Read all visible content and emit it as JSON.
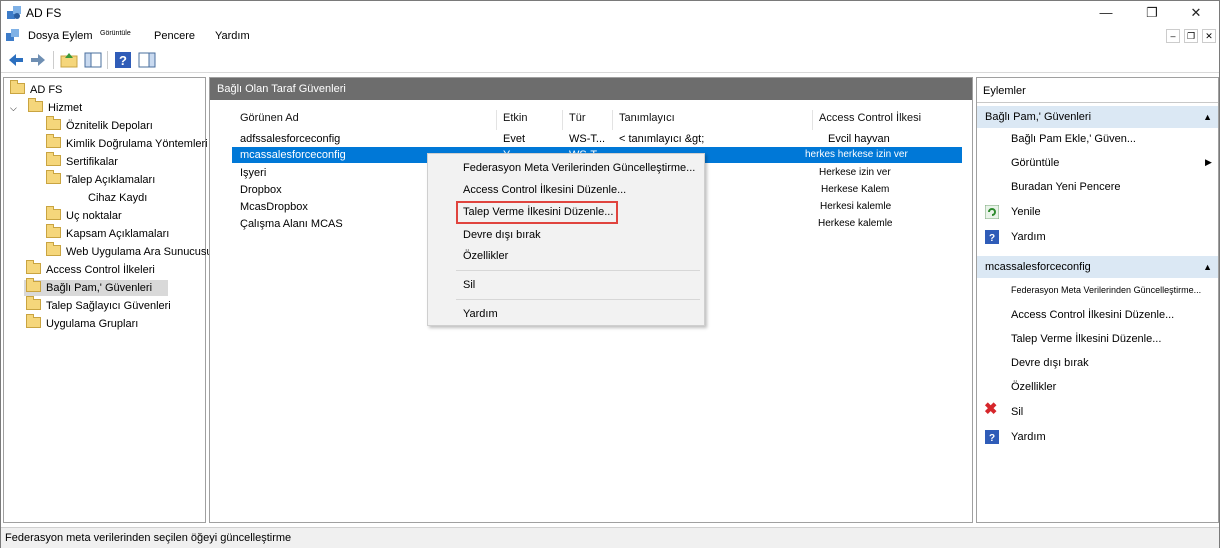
{
  "window": {
    "title": "AD FS",
    "minimize": "—",
    "maximize": "❐",
    "close": "✕"
  },
  "menu": {
    "file": "Dosya",
    "action": "Eylem",
    "view": "Görüntüle",
    "window": "Pencere",
    "help": "Yardım"
  },
  "tree": {
    "root": "AD FS",
    "service": "Hizmet",
    "children": [
      "Öznitelik Depoları",
      "Kimlik Doğrulama Yöntemleri",
      "Sertifikalar",
      "Talep Açıklamaları",
      "Cihaz Kaydı",
      "Uç noktalar",
      "Kapsam Açıklamaları",
      "Web Uygulama Ara Sunucusu"
    ],
    "access_control": "Access Control İlkeleri",
    "rp_trusts": "Bağlı Pam,' Güvenleri",
    "cp_trusts": "Talep Sağlayıcı Güvenleri",
    "app_groups": "Uygulama Grupları"
  },
  "center": {
    "title": "Bağlı Olan Taraf Güvenleri",
    "columns": {
      "display_name": "Görünen Ad",
      "enabled": "Etkin",
      "type": "Tür",
      "identifier": "Tanımlayıcı",
      "policy": "Access Control İlkesi"
    },
    "rows": [
      {
        "name": "adfssalesforceconfig",
        "enabled": "Evet",
        "type": "WS-T...",
        "identifier": "< tanımlayıcı &gt;",
        "policy": "Evcil hayvan"
      },
      {
        "name": "mcassalesforceconfig",
        "enabled": "Y...",
        "type": "WS-T...",
        "identifier": "",
        "policy": "herkes herkese izin ver"
      },
      {
        "name": "Işyeri",
        "enabled": "",
        "type": "",
        "identifier": "",
        "policy": "Herkese izin ver"
      },
      {
        "name": "Dropbox",
        "enabled": "",
        "type": "",
        "identifier": "",
        "policy": "Herkese Kalem"
      },
      {
        "name": "McasDropbox",
        "enabled": "",
        "type": "",
        "identifier": "",
        "policy": "Herkesi kalemle"
      },
      {
        "name": "Çalışma Alanı MCAS",
        "enabled": "",
        "type": "",
        "identifier": "",
        "policy": "Herkese kalemle"
      }
    ]
  },
  "context_menu": {
    "update_federation": "Federasyon Meta Verilerinden Güncelleştirme...",
    "edit_access": "Access Control İlkesini Düzenle...",
    "edit_claim": "Talep Verme İlkesini Düzenle...",
    "disable": "Devre dışı bırak",
    "properties": "Özellikler",
    "delete": "Sil",
    "help": "Yardım"
  },
  "actions": {
    "title": "Eylemler",
    "section1": "Bağlı Pam,' Güvenleri",
    "add": "Bağlı Pam Ekle,' Güven...",
    "view": "Görüntüle",
    "new_window": "Buradan Yeni Pencere",
    "refresh": "Yenile",
    "help1": "Yardım",
    "section2": "mcassalesforceconfig",
    "update": "Federasyon Meta Verilerinden Güncelleştirme...",
    "edit_access": "Access Control İlkesini Düzenle...",
    "edit_claim": "Talep Verme İlkesini Düzenle...",
    "disable": "Devre dışı bırak",
    "properties": "Özellikler",
    "delete": "Sil",
    "help2": "Yardım"
  },
  "status": {
    "text": "Federasyon meta verilerinden seçilen öğeyi güncelleştirme"
  },
  "colors": {
    "selection": "#0078d7",
    "highlight_box": "#e0443e",
    "header_gray": "#6d6d6d",
    "actions_head": "#dbe8f4"
  }
}
